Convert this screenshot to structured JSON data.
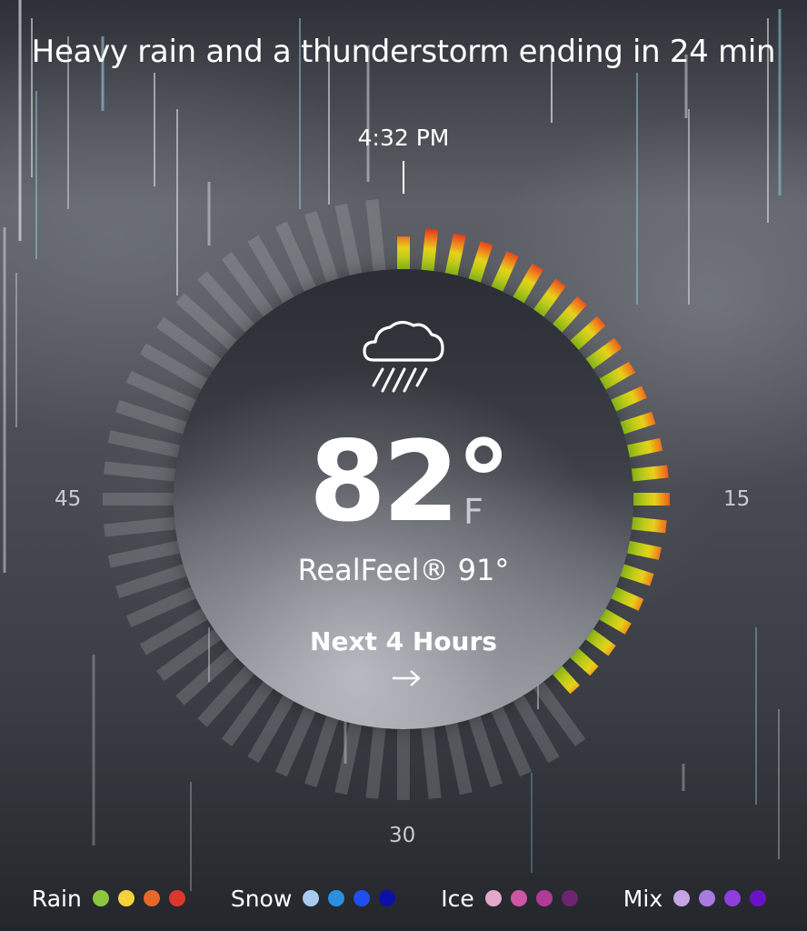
{
  "headline": "Heavy rain and a thunderstorm ending in 24 min",
  "current_time": "4:32 PM",
  "dial": {
    "label_15": "15",
    "label_30": "30",
    "label_45": "45",
    "precip_minutes_remaining": 24,
    "intensity_colors": [
      "#9cd11c",
      "#e6d21a",
      "#f07a1c",
      "#e02a1c"
    ]
  },
  "conditions": {
    "icon": "cloud-rain-icon",
    "temperature": "82°",
    "unit": "F",
    "realfeel": "RealFeel® 91°",
    "next_hours_link": "Next 4 Hours"
  },
  "legend": [
    {
      "label": "Rain",
      "colors": [
        "#8cc63f",
        "#f5d33a",
        "#e8672a",
        "#d9382b"
      ]
    },
    {
      "label": "Snow",
      "colors": [
        "#a9cbf0",
        "#2b8fe0",
        "#1f4ff0",
        "#0d0fa8"
      ]
    },
    {
      "label": "Ice",
      "colors": [
        "#e2a9cc",
        "#cc57a4",
        "#b03a96",
        "#6e2470"
      ]
    },
    {
      "label": "Mix",
      "colors": [
        "#c7a4e6",
        "#a77be0",
        "#8f3ddc",
        "#6a13c6"
      ]
    }
  ]
}
